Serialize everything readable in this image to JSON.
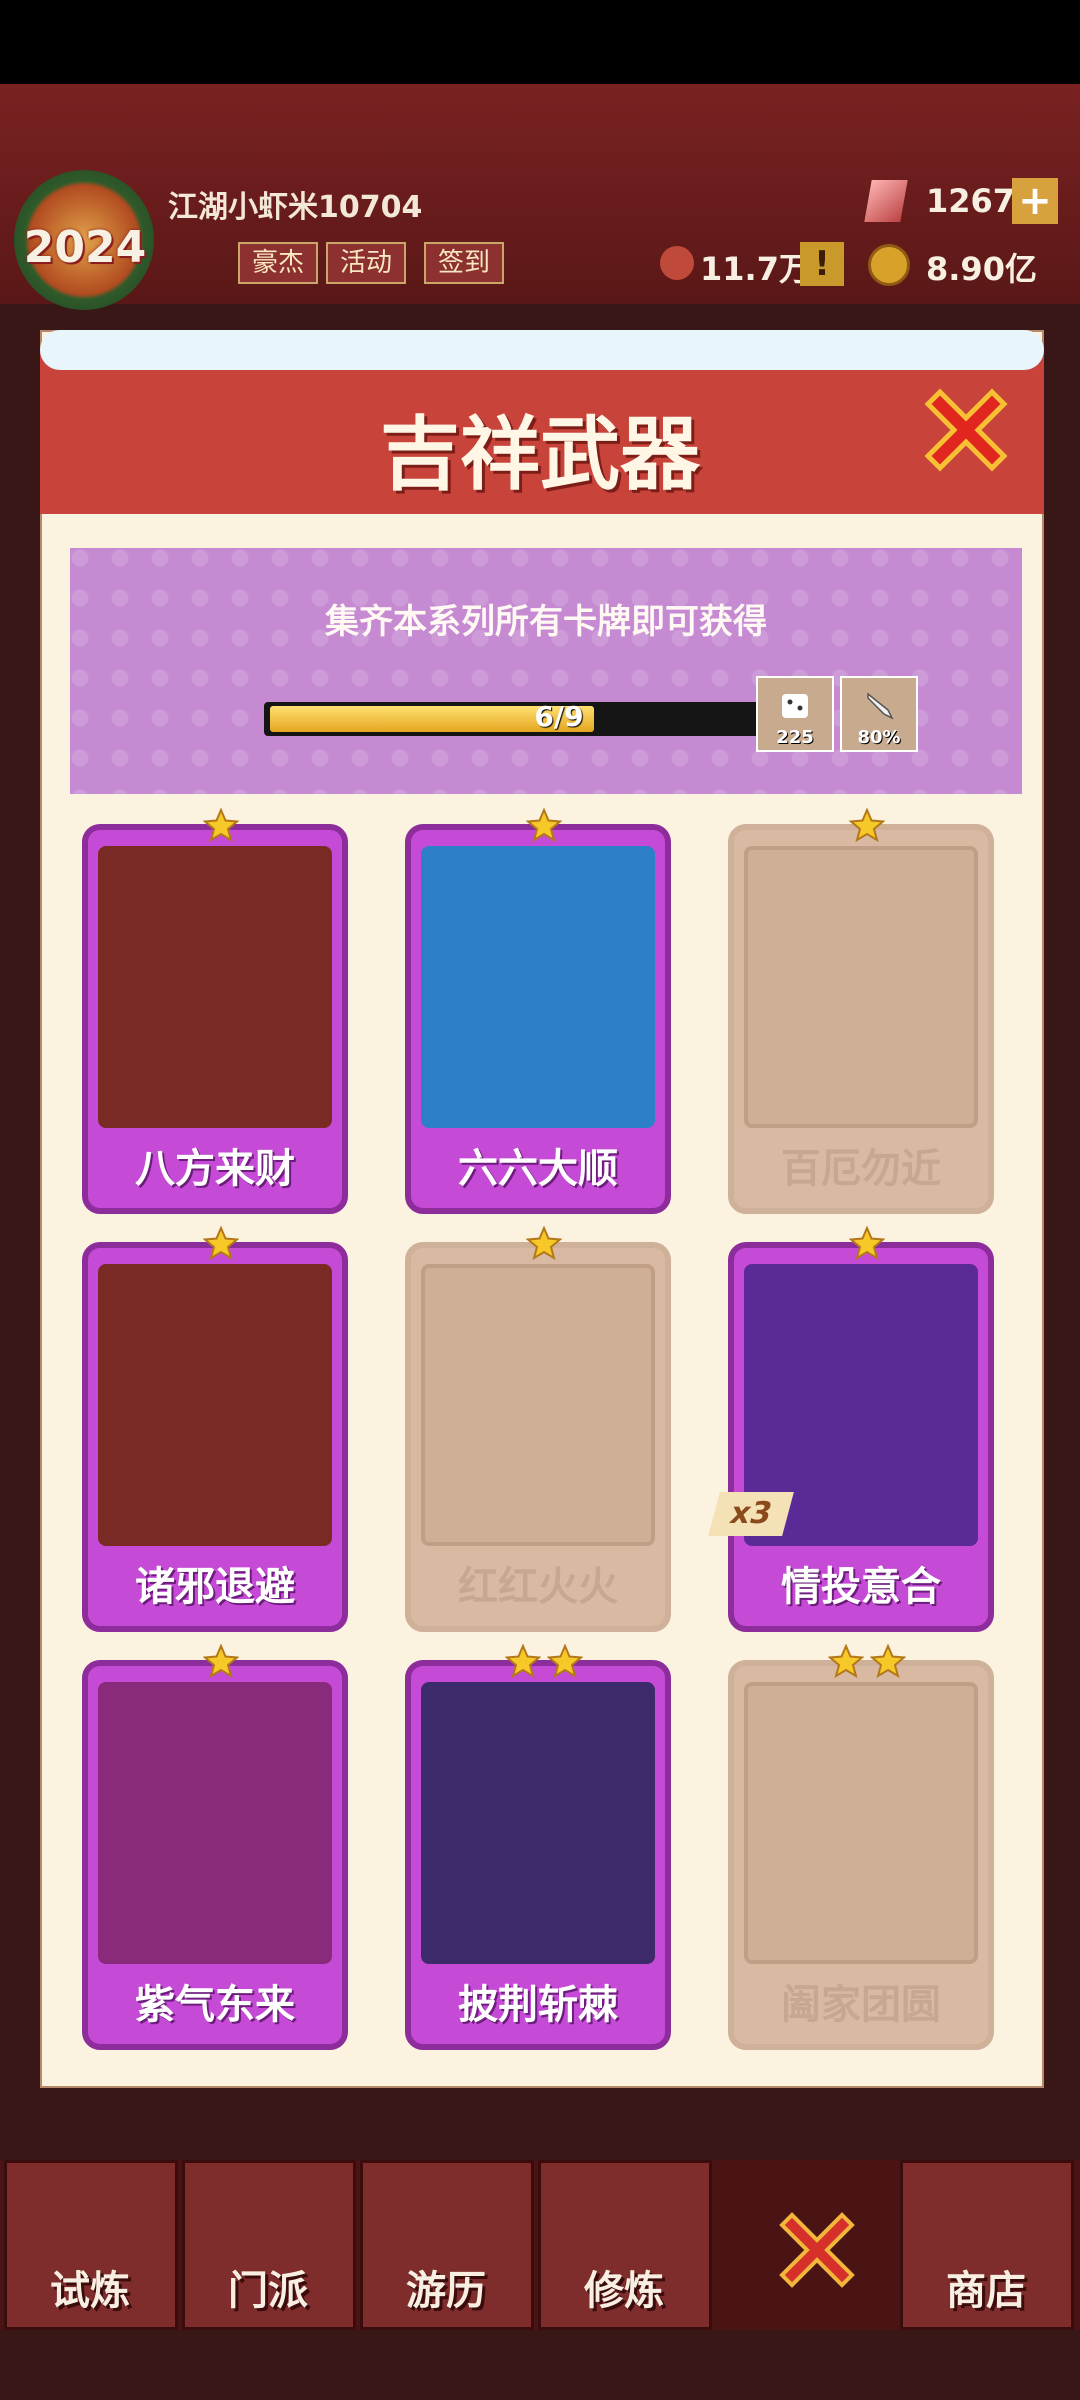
{
  "hud": {
    "logo_year": "2024",
    "player_name": "江湖小虾米10704",
    "buttons": [
      "豪杰",
      "活动",
      "签到"
    ],
    "gems": "1267",
    "power": "11.7万",
    "coins": "8.90亿"
  },
  "modal": {
    "title": "吉祥武器",
    "banner_text": "集齐本系列所有卡牌即可获得",
    "progress_text": "6/9",
    "progress_fraction": 0.667,
    "rewards": [
      {
        "icon": "dice-icon",
        "value": "225"
      },
      {
        "icon": "sword-icon",
        "value": "80%"
      }
    ]
  },
  "cards": [
    {
      "name": "八方来财",
      "owned": true,
      "stars": 1
    },
    {
      "name": "六六大顺",
      "owned": true,
      "stars": 1
    },
    {
      "name": "百厄勿近",
      "owned": false,
      "stars": 1
    },
    {
      "name": "诸邪退避",
      "owned": true,
      "stars": 1
    },
    {
      "name": "红红火火",
      "owned": false,
      "stars": 1
    },
    {
      "name": "情投意合",
      "owned": true,
      "stars": 1,
      "badge": "x3"
    },
    {
      "name": "紫气东来",
      "owned": true,
      "stars": 1
    },
    {
      "name": "披荆斩棘",
      "owned": true,
      "stars": 2
    },
    {
      "name": "阖家团圆",
      "owned": false,
      "stars": 2
    }
  ],
  "nav": {
    "tabs": [
      "试炼",
      "门派",
      "游历",
      "修炼",
      "",
      "商店"
    ]
  },
  "colors": {
    "header_red": "#c8433a",
    "card_purple": "#c54ad6",
    "card_locked": "#d9b9a1",
    "progress_yellow": "#f0b52a"
  }
}
